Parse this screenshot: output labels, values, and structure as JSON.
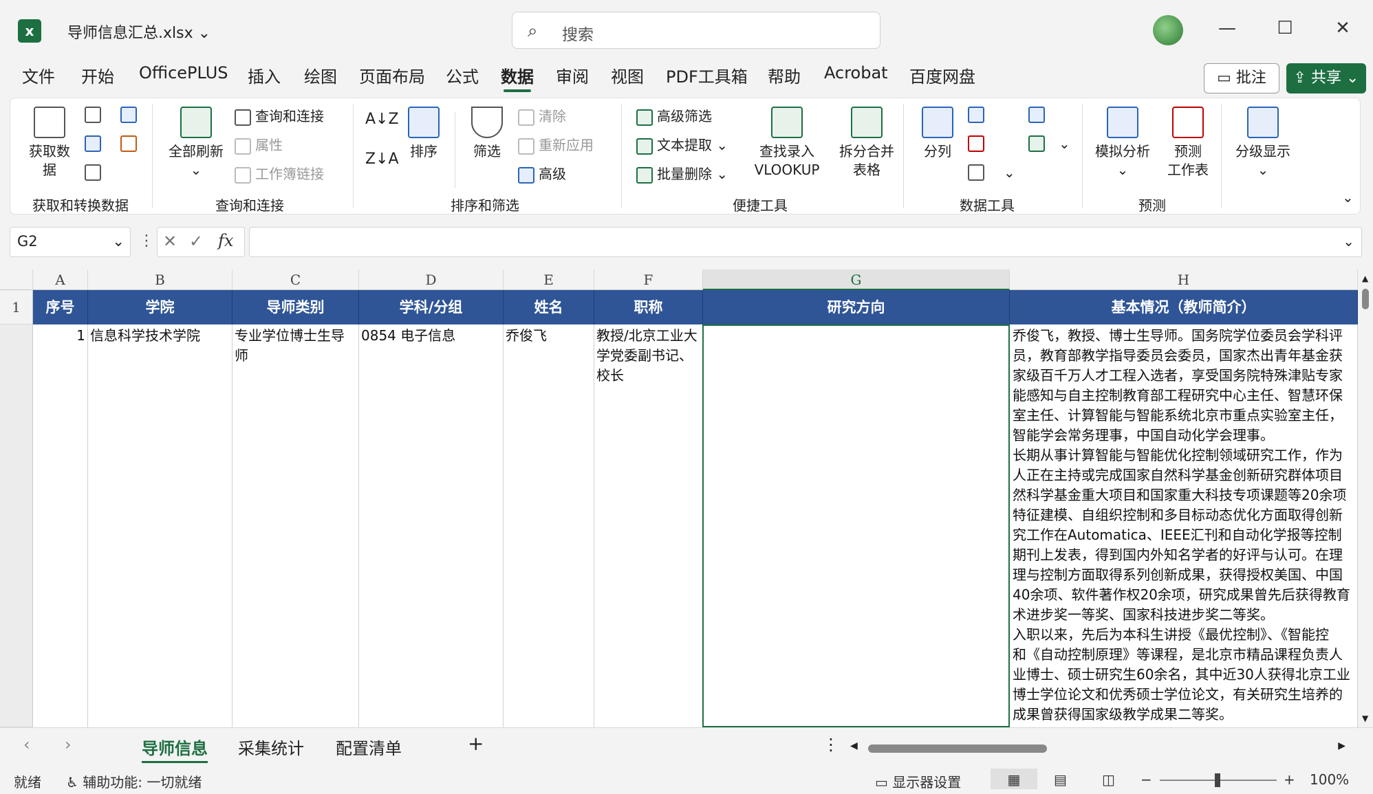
{
  "window": {
    "filename": "导师信息汇总.xlsx",
    "search_placeholder": "搜索"
  },
  "tabs": [
    "文件",
    "开始",
    "OfficePLUS",
    "插入",
    "绘图",
    "页面布局",
    "公式",
    "数据",
    "审阅",
    "视图",
    "PDF工具箱",
    "帮助",
    "Acrobat",
    "百度网盘"
  ],
  "active_tab": "数据",
  "header_buttons": {
    "comment": "批注",
    "share": "共享"
  },
  "ribbon": {
    "groups": {
      "get_transform": "获取和转换数据",
      "query_conn": "查询和连接",
      "sort_filter": "排序和筛选",
      "quick_tools": "便捷工具",
      "data_tools": "数据工具",
      "forecast": "预测"
    },
    "get_data": "获取数\n据",
    "refresh_all": "全部刷新",
    "query_connect": "查询和连接",
    "properties": "属性",
    "workbook_links": "工作簿链接",
    "sort": "排序",
    "filter": "筛选",
    "clear": "清除",
    "reapply": "重新应用",
    "advanced": "高级",
    "adv_filter": "高级筛选",
    "text_extract": "文本提取",
    "batch_delete": "批量删除",
    "vlookup": "查找录入\nVLOOKUP",
    "split_merge": "拆分合并\n表格",
    "text_to_columns": "分列",
    "what_if": "模拟分析",
    "forecast_sheet": "预测\n工作表",
    "outline": "分级显示"
  },
  "formula_bar": {
    "cell_ref": "G2",
    "fx": "fx",
    "formula": ""
  },
  "columns": [
    "A",
    "B",
    "C",
    "D",
    "E",
    "F",
    "G",
    "H"
  ],
  "selected_column": "G",
  "rows": [
    "1"
  ],
  "header_row": [
    "序号",
    "学院",
    "导师类别",
    "学科/分组",
    "姓名",
    "职称",
    "研究方向",
    "基本情况（教师简介）"
  ],
  "data_row": {
    "seq": "1",
    "college": "信息科学技术学院",
    "category": "专业学位博士生导师",
    "discipline": "0854 电子信息",
    "name": "乔俊飞",
    "title": "教授/北京工业大学党委副书记、校长",
    "research": "",
    "bio": "乔俊飞，教授、博士生导师。国务院学位委员会学科评\n员，教育部教学指导委员会委员，国家杰出青年基金获\n家级百千万人才工程入选者，享受国务院特殊津贴专家\n能感知与自主控制教育部工程研究中心主任、智慧环保\n室主任、计算智能与智能系统北京市重点实验室主任，\n智能学会常务理事，中国自动化学会理事。\n长期从事计算智能与智能优化控制领域研究工作，作为\n人正在主持或完成国家自然科学基金创新研究群体项目\n然科学基金重大项目和国家重大科技专项课题等20余项\n特征建模、自组织控制和多目标动态优化方面取得创新\n究工作在Automatica、IEEE汇刊和自动化学报等控制\n期刊上发表，得到国内外知名学者的好评与认可。在理\n理与控制方面取得系列创新成果，获得授权美国、中国\n40余项、软件著作权20余项，研究成果曾先后获得教育\n术进步奖一等奖、国家科技进步奖二等奖。\n入职以来，先后为本科生讲授《最优控制》、《智能控\n和《自动控制原理》等课程，是北京市精品课程负责人\n业博士、硕士研究生60余名，其中近30人获得北京工业\n博士学位论文和优秀硕士学位论文，有关研究生培养的\n成果曾获得国家级教学成果二等奖。"
  },
  "sheets": [
    "导师信息",
    "采集统计",
    "配置清单"
  ],
  "active_sheet": "导师信息",
  "status": {
    "ready": "就绪",
    "accessibility": "辅助功能: 一切就绪",
    "display_settings": "显示器设置",
    "zoom": "100%"
  }
}
